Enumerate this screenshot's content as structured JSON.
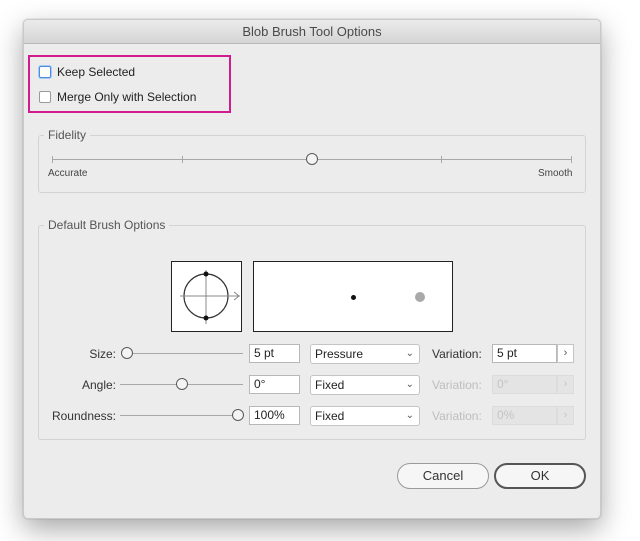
{
  "window": {
    "title": "Blob Brush Tool Options"
  },
  "checkboxes": {
    "keep_selected": {
      "label": "Keep Selected",
      "checked": false
    },
    "merge_only": {
      "label": "Merge Only with Selection",
      "checked": false
    }
  },
  "fidelity": {
    "group_label": "Fidelity",
    "min_label": "Accurate",
    "max_label": "Smooth",
    "value": 0.5
  },
  "brush": {
    "group_label": "Default Brush Options",
    "size": {
      "label": "Size:",
      "slider_value": 0.0,
      "value": "5 pt",
      "mode": "Pressure",
      "variation_label": "Variation:",
      "variation": "5 pt",
      "variation_enabled": true
    },
    "angle": {
      "label": "Angle:",
      "slider_value": 0.5,
      "value": "0°",
      "mode": "Fixed",
      "variation_label": "Variation:",
      "variation": "0°",
      "variation_enabled": false
    },
    "roundness": {
      "label": "Roundness:",
      "slider_value": 1.0,
      "value": "100%",
      "mode": "Fixed",
      "variation_label": "Variation:",
      "variation": "0%",
      "variation_enabled": false
    }
  },
  "buttons": {
    "cancel": "Cancel",
    "ok": "OK"
  },
  "icons": {
    "caret": "chevron-down-icon",
    "stepper": "chevron-right-icon"
  },
  "colors": {
    "highlight": "#d21c8c",
    "focus": "#4a8ee0"
  }
}
